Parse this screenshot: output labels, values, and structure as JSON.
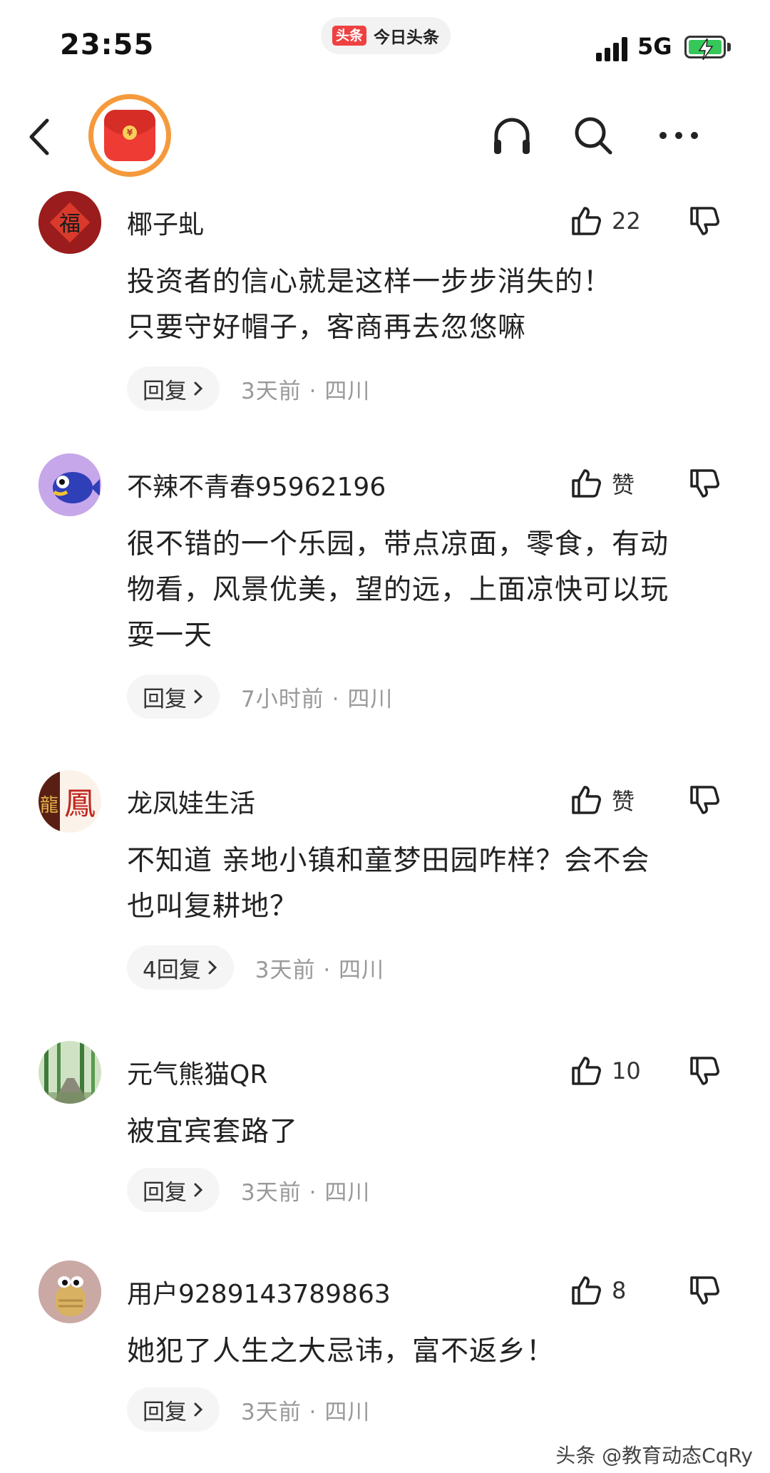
{
  "status_bar": {
    "time": "23:55",
    "app_logo": "头条",
    "app_name": "今日头条",
    "network": "5G"
  },
  "header": {
    "icons": [
      "back-icon",
      "red-packet-icon",
      "headphones-icon",
      "search-icon",
      "more-icon"
    ]
  },
  "comments": [
    {
      "username": "椰子虬",
      "likes": "22",
      "lines": [
        "投资者的信心就是这样一步步消失的！",
        "只要守好帽子，客商再去忽悠嘛"
      ],
      "reply_label": "回复",
      "time": "3天前",
      "location": "四川",
      "avatar": "fu-character-avatar"
    },
    {
      "username": "不辣不青春95962196",
      "likes": "赞",
      "lines": [
        "很不错的一个乐园，带点凉面，零食，有动",
        "物看，风景优美，望的远，上面凉快可以玩",
        "耍一天"
      ],
      "reply_label": "回复",
      "time": "7小时前",
      "location": "四川",
      "avatar": "fish-avatar"
    },
    {
      "username": "龙凤娃生活",
      "likes": "赞",
      "lines": [
        "不知道 亲地小镇和童梦田园咋样？会不会",
        "也叫复耕地？"
      ],
      "reply_label": "4回复",
      "time": "3天前",
      "location": "四川",
      "avatar": "dragon-phoenix-avatar"
    },
    {
      "username": "元气熊猫QR",
      "likes": "10",
      "lines": [
        "被宜宾套路了"
      ],
      "reply_label": "回复",
      "time": "3天前",
      "location": "四川",
      "avatar": "bamboo-forest-avatar"
    },
    {
      "username": "用户9289143789863",
      "likes": "8",
      "lines": [
        "她犯了人生之大忌讳，富不返乡！"
      ],
      "reply_label": "回复",
      "time": "3天前",
      "location": "四川",
      "avatar": "cartoon-creature-avatar"
    }
  ],
  "meta_separator": "·",
  "watermark": "头条 @教育动态CqRy",
  "colors": {
    "accent_orange": "#f59a3c",
    "red_packet": "#ee3b34",
    "meta_gray": "#999999",
    "reply_bg": "#f5f5f5"
  }
}
